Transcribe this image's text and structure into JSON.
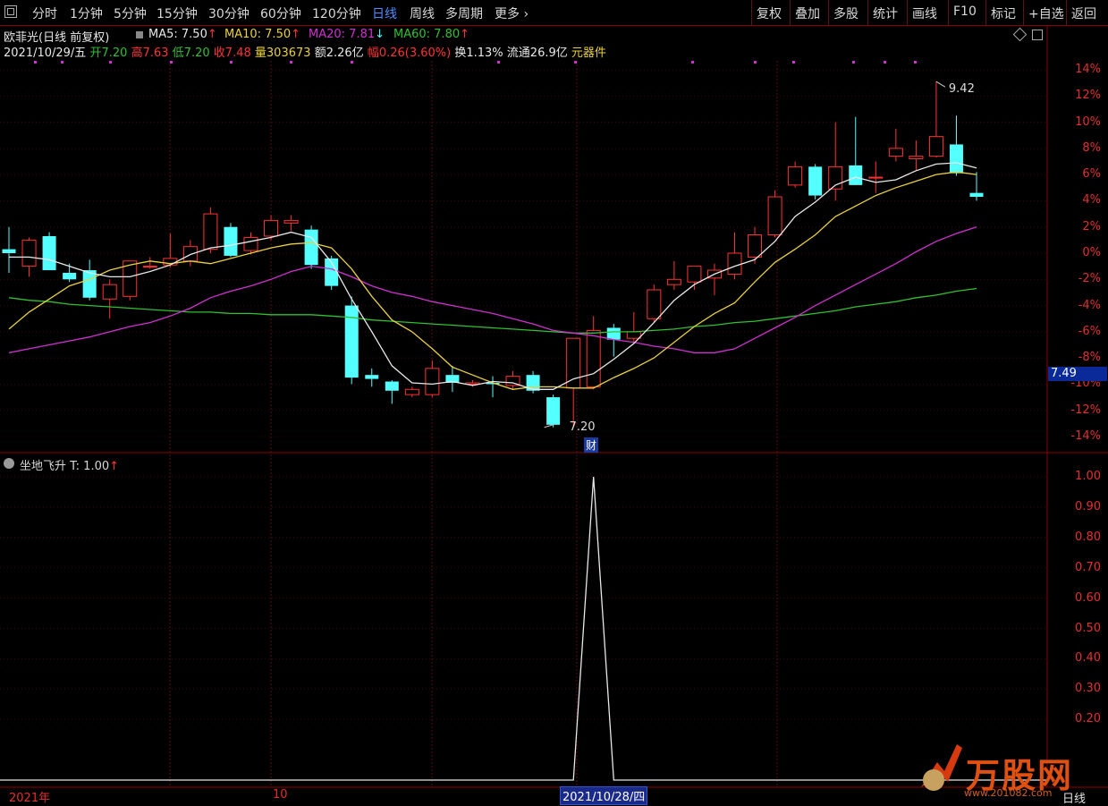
{
  "toolbar": {
    "left_items": [
      "分时",
      "1分钟",
      "5分钟",
      "15分钟",
      "30分钟",
      "60分钟",
      "120分钟",
      "日线",
      "周线",
      "多周期",
      "更多"
    ],
    "active": "日线",
    "more_arrow": "›",
    "right_items": [
      "复权",
      "叠加",
      "多股",
      "统计",
      "画线",
      "F10",
      "标记",
      "+自选",
      "返回"
    ]
  },
  "header": {
    "stock": "欧菲光(日线 前复权)",
    "ma5": "MA5: 7.50",
    "ma10": "MA10: 7.50",
    "ma20": "MA20: 7.81",
    "ma60": "MA60: 7.80",
    "ma5_arrow": "↑",
    "ma10_arrow": "↑",
    "ma20_arrow": "↓",
    "ma60_arrow": "↑",
    "date": "2021/10/29/五",
    "open_label": "开",
    "open": "7.20",
    "high_label": "高",
    "high": "7.63",
    "low_label": "低",
    "low": "7.20",
    "close_label": "收",
    "close": "7.48",
    "vol_label": "量",
    "vol": "303673",
    "amt_label": "额",
    "amt": "2.26亿",
    "chg_label": "幅",
    "chg": "0.26(3.60%)",
    "turnover": "换1.13%",
    "float": "流通26.9亿",
    "sector": "元器件"
  },
  "indicator": {
    "title": "坐地飞升",
    "value": "T: 1.00",
    "arrow": "↑"
  },
  "price_tag": "7.49",
  "high_marker": "9.42",
  "low_marker": "7.20",
  "cai_marker": "财",
  "x_labels": {
    "year": "2021年",
    "month": "10",
    "highlight": "2021/10/28/四",
    "period": "日线"
  },
  "watermark": {
    "logo": "万股网",
    "url": "www.201082.com"
  },
  "colors": {
    "up": "#ff3232",
    "down": "#54ffff",
    "ma5": "#e8e8e8",
    "ma10": "#e8d040",
    "ma20": "#d030d0",
    "ma60": "#30c030",
    "axis": "#8b0000"
  },
  "chart_data": [
    {
      "type": "candlestick",
      "title": "欧菲光(日线 前复权)",
      "y_axis": "percent",
      "ylim": [
        -15,
        15
      ],
      "yticks": [
        "14%",
        "12%",
        "10%",
        "8%",
        "6%",
        "4%",
        "2%",
        "0%",
        "-2%",
        "-4%",
        "-6%",
        "-8%",
        "-10%",
        "-12%",
        "-14%"
      ],
      "candles": [
        {
          "o": 0.3,
          "h": 2.0,
          "l": -1.5,
          "c": 0.0
        },
        {
          "o": -1.0,
          "h": 1.2,
          "l": -1.8,
          "c": 1.0
        },
        {
          "o": 1.3,
          "h": 1.6,
          "l": -1.3,
          "c": -1.3
        },
        {
          "o": -1.5,
          "h": -0.8,
          "l": -2.2,
          "c": -2.0
        },
        {
          "o": -1.3,
          "h": -0.5,
          "l": -3.6,
          "c": -3.4
        },
        {
          "o": -3.5,
          "h": -2.0,
          "l": -5.0,
          "c": -2.4
        },
        {
          "o": -3.3,
          "h": -0.6,
          "l": -3.6,
          "c": -0.6
        },
        {
          "o": -1.0,
          "h": -0.3,
          "l": -1.2,
          "c": -1.0
        },
        {
          "o": -0.9,
          "h": 1.5,
          "l": -1.1,
          "c": -0.4
        },
        {
          "o": -0.6,
          "h": 1.0,
          "l": -1.0,
          "c": 0.5
        },
        {
          "o": 0.3,
          "h": 3.5,
          "l": 0.0,
          "c": 3.0
        },
        {
          "o": 2.0,
          "h": 2.3,
          "l": -0.3,
          "c": -0.2
        },
        {
          "o": 0.2,
          "h": 1.6,
          "l": -0.1,
          "c": 1.2
        },
        {
          "o": 1.3,
          "h": 2.9,
          "l": 1.0,
          "c": 2.5
        },
        {
          "o": 2.3,
          "h": 2.9,
          "l": 1.7,
          "c": 2.5
        },
        {
          "o": 1.8,
          "h": 2.1,
          "l": -1.2,
          "c": -0.9
        },
        {
          "o": -0.4,
          "h": -0.2,
          "l": -2.8,
          "c": -2.5
        },
        {
          "o": -4.0,
          "h": -3.3,
          "l": -10.0,
          "c": -9.5
        },
        {
          "o": -9.3,
          "h": -8.8,
          "l": -10.2,
          "c": -9.6
        },
        {
          "o": -9.8,
          "h": -9.7,
          "l": -11.5,
          "c": -10.5
        },
        {
          "o": -10.8,
          "h": -10.2,
          "l": -11.0,
          "c": -10.4
        },
        {
          "o": -10.8,
          "h": -8.2,
          "l": -11.0,
          "c": -8.8
        },
        {
          "o": -9.3,
          "h": -8.6,
          "l": -10.6,
          "c": -9.9
        },
        {
          "o": -10.0,
          "h": -9.7,
          "l": -10.2,
          "c": -9.9
        },
        {
          "o": -9.9,
          "h": -9.4,
          "l": -11.0,
          "c": -10.0
        },
        {
          "o": -10.1,
          "h": -9.0,
          "l": -10.4,
          "c": -9.4
        },
        {
          "o": -9.3,
          "h": -9.0,
          "l": -10.7,
          "c": -10.5
        },
        {
          "o": -11.0,
          "h": -10.8,
          "l": -13.3,
          "c": -13.1
        },
        {
          "o": -10.3,
          "h": -6.8,
          "l": -13.3,
          "c": -6.5
        },
        {
          "o": -10.2,
          "h": -4.8,
          "l": -10.4,
          "c": -5.9
        },
        {
          "o": -5.7,
          "h": -5.4,
          "l": -7.9,
          "c": -6.6
        },
        {
          "o": -6.5,
          "h": -4.5,
          "l": -6.9,
          "c": -6.0
        },
        {
          "o": -5.0,
          "h": -2.4,
          "l": -5.3,
          "c": -2.8
        },
        {
          "o": -2.4,
          "h": -0.6,
          "l": -2.8,
          "c": -2.0
        },
        {
          "o": -2.2,
          "h": -1.1,
          "l": -2.8,
          "c": -1.0
        },
        {
          "o": -1.9,
          "h": -0.8,
          "l": -3.2,
          "c": -1.3
        },
        {
          "o": -1.6,
          "h": 1.6,
          "l": -2.0,
          "c": 0.0
        },
        {
          "o": -0.3,
          "h": 2.0,
          "l": -0.8,
          "c": 1.4
        },
        {
          "o": 1.4,
          "h": 4.8,
          "l": 1.2,
          "c": 4.3
        },
        {
          "o": 5.2,
          "h": 7.0,
          "l": 5.0,
          "c": 6.6
        },
        {
          "o": 6.6,
          "h": 6.8,
          "l": 4.1,
          "c": 4.4
        },
        {
          "o": 4.9,
          "h": 10.0,
          "l": 4.0,
          "c": 6.6
        },
        {
          "o": 6.7,
          "h": 10.4,
          "l": 5.2,
          "c": 5.2
        },
        {
          "o": 5.8,
          "h": 7.0,
          "l": 4.6,
          "c": 5.8
        },
        {
          "o": 7.4,
          "h": 9.5,
          "l": 7.0,
          "c": 8.0
        },
        {
          "o": 7.2,
          "h": 8.6,
          "l": 6.3,
          "c": 7.4
        },
        {
          "o": 7.4,
          "h": 13.1,
          "l": 7.3,
          "c": 8.9
        },
        {
          "o": 8.3,
          "h": 10.5,
          "l": 5.9,
          "c": 6.1
        },
        {
          "o": 4.6,
          "h": 6.2,
          "l": 4.0,
          "c": 4.3
        }
      ],
      "ma5": [
        -0.3,
        -0.3,
        -0.5,
        -1.0,
        -1.5,
        -1.8,
        -1.8,
        -1.4,
        -0.9,
        -0.1,
        0.4,
        0.6,
        0.9,
        1.2,
        1.6,
        1.2,
        -0.7,
        -3.5,
        -6.0,
        -8.6,
        -9.9,
        -10.0,
        -9.8,
        -10.1,
        -9.8,
        -9.9,
        -10.4,
        -10.4,
        -9.6,
        -9.2,
        -8.1,
        -6.9,
        -5.3,
        -3.6,
        -2.4,
        -1.6,
        -1.0,
        -0.5,
        0.9,
        2.8,
        3.9,
        5.2,
        5.8,
        5.4,
        5.6,
        6.3,
        6.8,
        6.9,
        6.5
      ],
      "ma10": [
        -5.8,
        -4.5,
        -3.5,
        -2.5,
        -2.0,
        -1.3,
        -0.9,
        -0.6,
        -0.8,
        -0.6,
        -0.8,
        -0.4,
        0.0,
        0.4,
        0.7,
        0.8,
        0.4,
        -1.2,
        -3.3,
        -5.1,
        -6.0,
        -7.3,
        -8.7,
        -9.3,
        -9.9,
        -10.4,
        -10.2,
        -10.2,
        -10.3,
        -10.3,
        -9.5,
        -8.8,
        -8.0,
        -6.8,
        -5.6,
        -4.6,
        -3.8,
        -2.2,
        -0.7,
        0.3,
        1.4,
        2.8,
        3.6,
        4.4,
        5.0,
        5.5,
        6.0,
        6.2,
        6.0
      ],
      "ma20": [
        -7.6,
        -7.3,
        -7.0,
        -6.7,
        -6.4,
        -6.0,
        -5.6,
        -5.3,
        -4.8,
        -4.2,
        -3.4,
        -2.9,
        -2.5,
        -2.0,
        -1.4,
        -1.0,
        -1.2,
        -1.8,
        -2.5,
        -3.0,
        -3.3,
        -3.7,
        -4.0,
        -4.3,
        -4.6,
        -5.0,
        -5.4,
        -5.9,
        -6.1,
        -6.3,
        -6.6,
        -6.8,
        -7.1,
        -7.3,
        -7.6,
        -7.6,
        -7.3,
        -6.5,
        -5.7,
        -4.9,
        -4.0,
        -3.2,
        -2.4,
        -1.6,
        -0.8,
        0.1,
        0.9,
        1.5,
        2.0
      ],
      "ma60": [
        -3.4,
        -3.6,
        -3.7,
        -3.9,
        -4.0,
        -4.1,
        -4.2,
        -4.3,
        -4.4,
        -4.5,
        -4.5,
        -4.6,
        -4.6,
        -4.7,
        -4.7,
        -4.7,
        -4.8,
        -4.9,
        -5.1,
        -5.2,
        -5.3,
        -5.4,
        -5.5,
        -5.6,
        -5.7,
        -5.8,
        -5.9,
        -6.0,
        -6.1,
        -6.1,
        -6.0,
        -6.0,
        -5.9,
        -5.8,
        -5.6,
        -5.5,
        -5.3,
        -5.2,
        -5.0,
        -4.8,
        -4.6,
        -4.4,
        -4.1,
        -3.9,
        -3.7,
        -3.4,
        -3.2,
        -2.9,
        -2.7
      ]
    },
    {
      "type": "line",
      "title": "坐地飞升",
      "ylim": [
        0,
        1.05
      ],
      "yticks": [
        "1.00",
        "0.90",
        "0.80",
        "0.70",
        "0.60",
        "0.50",
        "0.40",
        "0.30",
        "0.20"
      ],
      "values": [
        0,
        0,
        0,
        0,
        0,
        0,
        0,
        0,
        0,
        0,
        0,
        0,
        0,
        0,
        0,
        0,
        0,
        0,
        0,
        0,
        0,
        0,
        0,
        0,
        0,
        0,
        0,
        0,
        0,
        1,
        0,
        0,
        0,
        0,
        0,
        0,
        0,
        0,
        0,
        0,
        0,
        0,
        0,
        0,
        0,
        0,
        0,
        0,
        0
      ]
    }
  ]
}
